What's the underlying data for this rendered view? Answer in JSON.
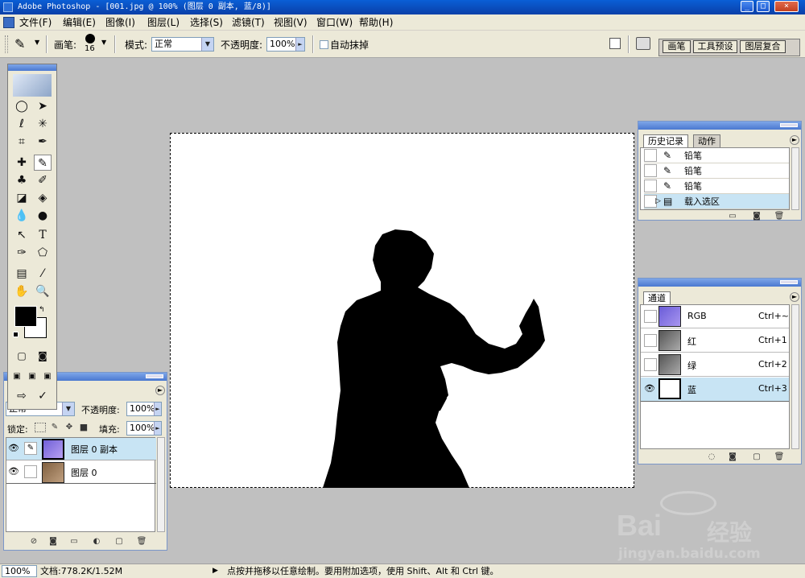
{
  "window": {
    "title": "Adobe Photoshop - [001.jpg @ 100% (图层 0 副本, 蓝/8)]",
    "controls": [
      "_",
      "□",
      "×"
    ]
  },
  "menu": [
    "文件(F)",
    "编辑(E)",
    "图像(I)",
    "图层(L)",
    "选择(S)",
    "滤镜(T)",
    "视图(V)",
    "窗口(W)",
    "帮助(H)"
  ],
  "options": {
    "brush_label": "画笔:",
    "brush_size": "16",
    "mode_label": "模式:",
    "mode_value": "正常",
    "opacity_label": "不透明度:",
    "opacity_value": "100%",
    "auto_erase_label": "自动抹掉",
    "tabs": [
      "画笔",
      "工具预设",
      "图层复合"
    ]
  },
  "history_panel": {
    "tabs": [
      "历史记录",
      "动作"
    ],
    "items": [
      "铅笔",
      "铅笔",
      "铅笔",
      "载入选区"
    ]
  },
  "channels_panel": {
    "tab": "通道",
    "channels": [
      {
        "name": "RGB",
        "shortcut": "Ctrl+~"
      },
      {
        "name": "红",
        "shortcut": "Ctrl+1"
      },
      {
        "name": "绿",
        "shortcut": "Ctrl+2"
      },
      {
        "name": "蓝",
        "shortcut": "Ctrl+3"
      }
    ]
  },
  "layers_panel": {
    "mode_value": "正常",
    "opacity_label": "不透明度:",
    "opacity_value": "100%",
    "lock_label": "锁定:",
    "fill_label": "填充:",
    "fill_value": "100%",
    "layers": [
      {
        "name": "图层 0 副本"
      },
      {
        "name": "图层 0"
      }
    ]
  },
  "status": {
    "zoom": "100%",
    "doc": "文档:778.2K/1.52M",
    "hint": "点按并拖移以任意绘制。要用附加选项，使用 Shift、Alt 和 Ctrl 键。"
  },
  "watermark": {
    "brand": "Bai",
    "brand_suffix": "经验",
    "url": "jingyan.baidu.com"
  },
  "colors": {
    "title_bar": "#0a4fc0",
    "panel_bg": "#ece9d8",
    "workspace": "#c0c0c0",
    "selection_highlight": "#c8e4f4"
  }
}
